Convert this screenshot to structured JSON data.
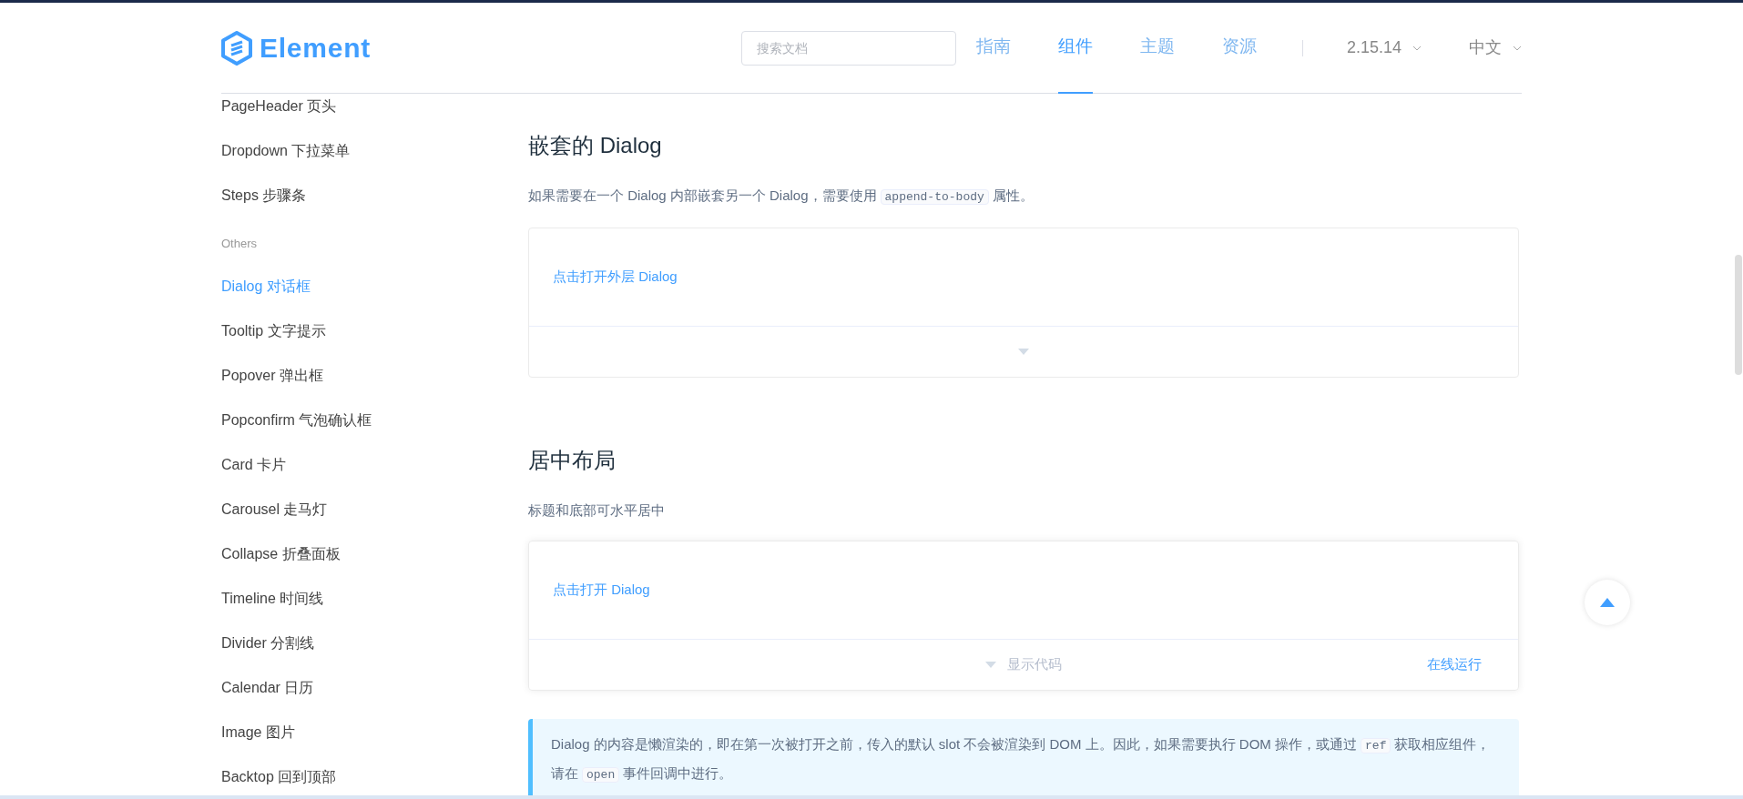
{
  "header": {
    "logo": "Element",
    "search": {
      "placeholder": "搜索文档"
    },
    "nav": [
      {
        "label": "指南",
        "selected": false
      },
      {
        "label": "组件",
        "selected": true
      },
      {
        "label": "主题",
        "selected": false
      },
      {
        "label": "资源",
        "selected": false
      }
    ],
    "version": "2.15.14",
    "language": "中文"
  },
  "sidebar": {
    "items": [
      {
        "kind": "item",
        "label": "PageHeader 页头",
        "selected": false
      },
      {
        "kind": "item",
        "label": "Dropdown 下拉菜单",
        "selected": false
      },
      {
        "kind": "item",
        "label": "Steps 步骤条",
        "selected": false
      },
      {
        "kind": "group",
        "label": "Others"
      },
      {
        "kind": "item",
        "label": "Dialog 对话框",
        "selected": true
      },
      {
        "kind": "item",
        "label": "Tooltip 文字提示",
        "selected": false
      },
      {
        "kind": "item",
        "label": "Popover 弹出框",
        "selected": false
      },
      {
        "kind": "item",
        "label": "Popconfirm 气泡确认框",
        "selected": false
      },
      {
        "kind": "item",
        "label": "Card 卡片",
        "selected": false
      },
      {
        "kind": "item",
        "label": "Carousel 走马灯",
        "selected": false
      },
      {
        "kind": "item",
        "label": "Collapse 折叠面板",
        "selected": false
      },
      {
        "kind": "item",
        "label": "Timeline 时间线",
        "selected": false
      },
      {
        "kind": "item",
        "label": "Divider 分割线",
        "selected": false
      },
      {
        "kind": "item",
        "label": "Calendar 日历",
        "selected": false
      },
      {
        "kind": "item",
        "label": "Image 图片",
        "selected": false
      },
      {
        "kind": "item",
        "label": "Backtop 回到顶部",
        "selected": false
      }
    ]
  },
  "sections": [
    {
      "title": "嵌套的 Dialog",
      "description": [
        {
          "kind": "text",
          "text": "如果需要在一个 Dialog 内部嵌套另一个 Dialog，需要使用"
        },
        {
          "kind": "code",
          "text": "append-to-body"
        },
        {
          "kind": "text",
          "text": "属性。"
        }
      ],
      "demo": {
        "link": "点击打开外层 Dialog"
      }
    },
    {
      "title": "居中布局",
      "description": [
        {
          "kind": "text",
          "text": "标题和底部可水平居中"
        }
      ],
      "demo": {
        "link": "点击打开 Dialog",
        "show_code": "显示代码",
        "run_online": "在线运行"
      }
    }
  ],
  "tip": [
    {
      "kind": "text",
      "text": "Dialog 的内容是懒渲染的，即在第一次被打开之前，传入的默认 slot 不会被渲染到 DOM 上。因此，如果需要执行 DOM 操作，或通过"
    },
    {
      "kind": "code",
      "text": "ref"
    },
    {
      "kind": "text",
      "text": "获取相应组件，请在"
    },
    {
      "kind": "code",
      "text": "open"
    },
    {
      "kind": "text",
      "text": "事件回调中进行。"
    }
  ]
}
